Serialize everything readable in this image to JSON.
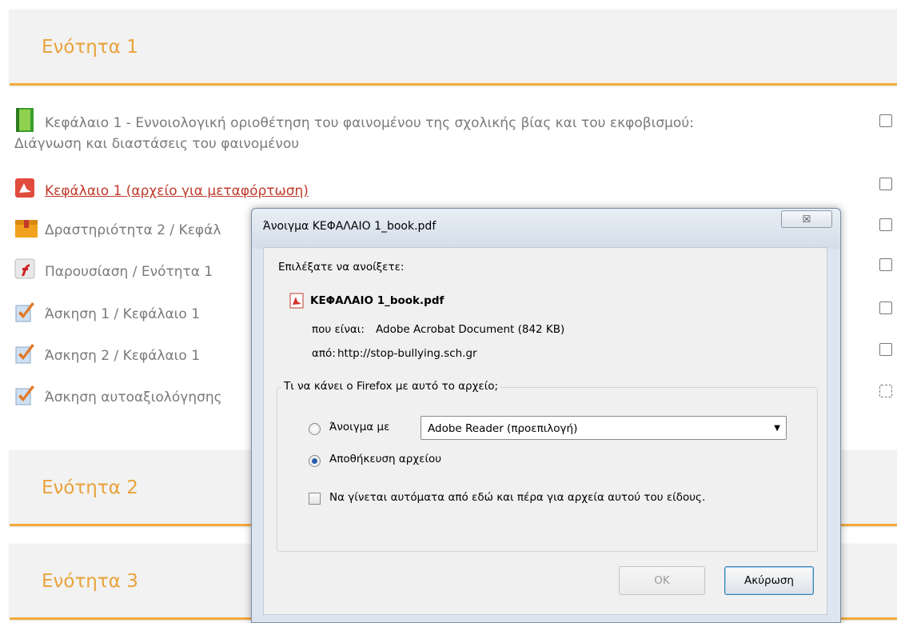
{
  "sections": [
    {
      "title": "Ενότητα 1"
    },
    {
      "title": "Ενότητα 2"
    },
    {
      "title": "Ενότητα 3"
    }
  ],
  "activities": [
    {
      "icon": "book-icon",
      "label": "Κεφάλαιο 1 - Εννοιολογική οριοθέτηση του φαινομένου της σχολικής βίας και του εκφοβισμού:",
      "label2": "Διάγνωση και διαστάσεις του φαινομένου"
    },
    {
      "icon": "pdf-icon",
      "label": "Κεφάλαιο 1 (αρχείο για μεταφόρτωση)"
    },
    {
      "icon": "package-icon",
      "label": "Δραστηριότητα 2 / Κεφάλ"
    },
    {
      "icon": "flash-icon",
      "label": "Παρουσίαση / Ενότητα 1"
    },
    {
      "icon": "quiz-icon",
      "label": "Άσκηση 1 / Κεφάλαιο 1"
    },
    {
      "icon": "quiz-icon",
      "label": "Άσκηση 2 / Κεφάλαιο 1"
    },
    {
      "icon": "quiz-icon",
      "label": "Άσκηση αυτοαξιολόγησης"
    }
  ],
  "dialog": {
    "title": "Άνοιγμα ΚΕΦΑΛΑΙΟ 1_book.pdf",
    "close_label": "☒",
    "choose_label": "Επιλέξατε να ανοίξετε:",
    "filename": "ΚΕΦΑΛΑΙΟ 1_book.pdf",
    "type_label": "που είναι:",
    "type_value": "Adobe Acrobat Document (842 KB)",
    "from_label": "από:",
    "from_value": "http://stop-bullying.sch.gr",
    "group_label": "Τι να κάνει ο Firefox  με αυτό το αρχείο;",
    "open_with_label": "Άνοιγμα με",
    "open_with_value": "Adobe Reader  (προεπιλογή)",
    "open_with_selected": false,
    "save_label": "Αποθήκευση αρχείου",
    "save_selected": true,
    "auto_label": "Να γίνεται αυτόματα από εδώ και πέρα για αρχεία αυτού του είδους.",
    "auto_checked": false,
    "ok_label": "OK",
    "cancel_label": "Ακύρωση"
  }
}
